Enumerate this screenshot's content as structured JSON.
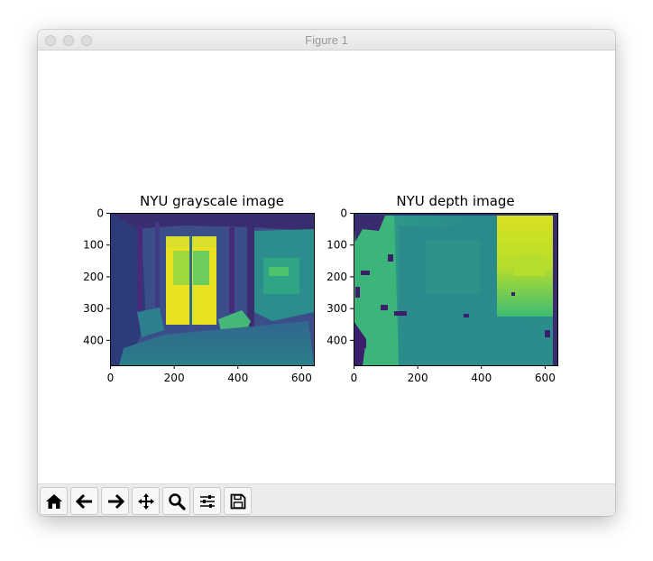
{
  "window": {
    "title": "Figure 1"
  },
  "figures": [
    {
      "title": "NYU grayscale image",
      "x_ticks": [
        "0",
        "200",
        "400",
        "600"
      ],
      "y_ticks": [
        "0",
        "100",
        "200",
        "300",
        "400"
      ]
    },
    {
      "title": "NYU depth image",
      "x_ticks": [
        "0",
        "200",
        "400",
        "600"
      ],
      "y_ticks": [
        "0",
        "100",
        "200",
        "300",
        "400"
      ]
    }
  ],
  "toolbar": {
    "buttons": [
      {
        "icon": "home-icon"
      },
      {
        "icon": "back-arrow-icon"
      },
      {
        "icon": "forward-arrow-icon"
      },
      {
        "icon": "pan-icon"
      },
      {
        "icon": "zoom-icon"
      },
      {
        "icon": "configure-subplots-icon"
      },
      {
        "icon": "save-icon"
      }
    ]
  }
}
